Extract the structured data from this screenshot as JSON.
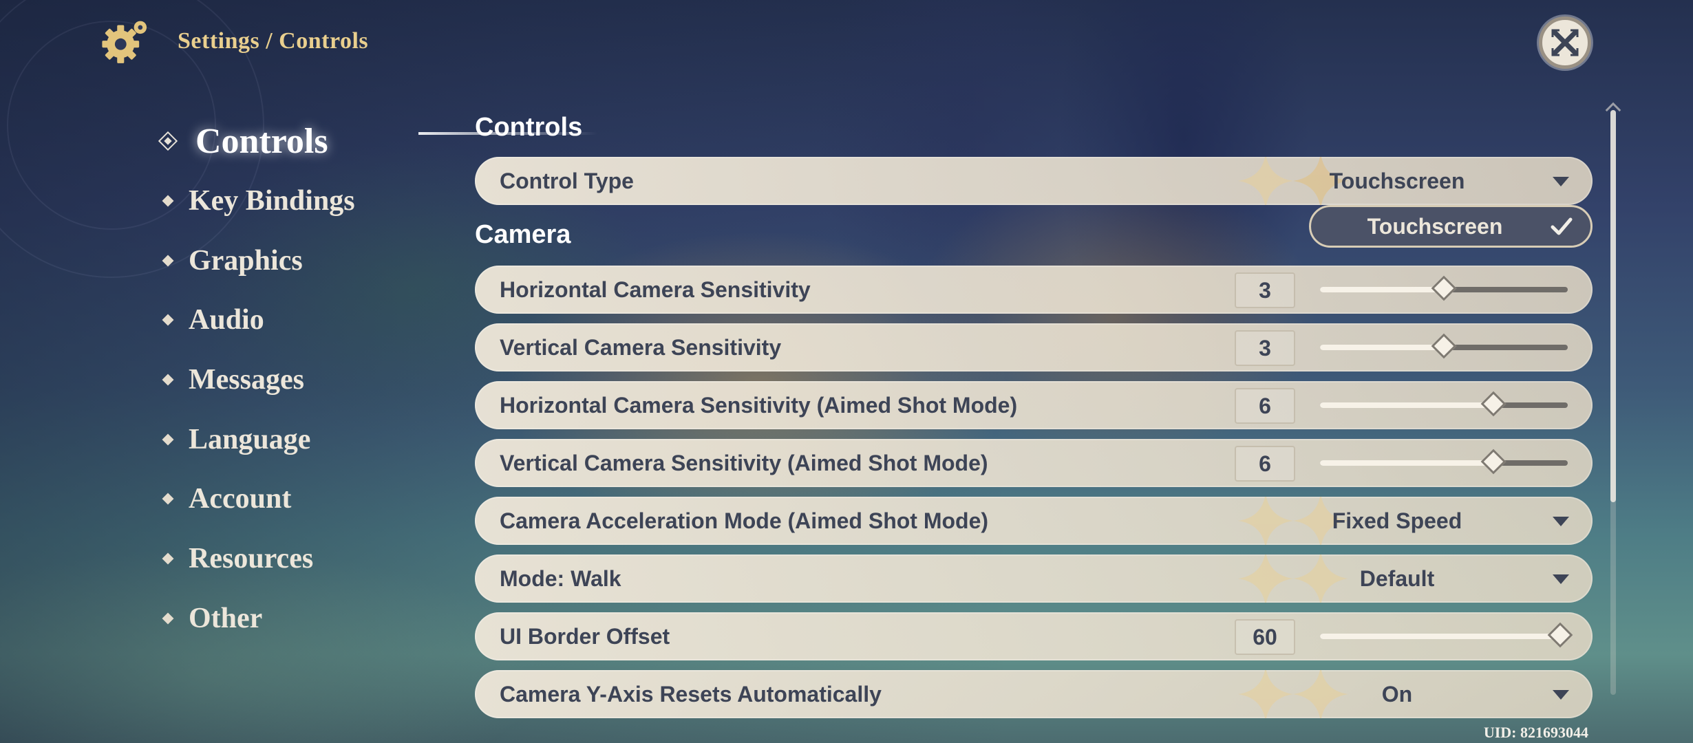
{
  "header": {
    "icon": "gear-icon",
    "breadcrumb": "Settings / Controls",
    "close_icon": "close-icon"
  },
  "sidebar": {
    "items": [
      {
        "label": "Controls",
        "active": true
      },
      {
        "label": "Key Bindings"
      },
      {
        "label": "Graphics"
      },
      {
        "label": "Audio"
      },
      {
        "label": "Messages"
      },
      {
        "label": "Language"
      },
      {
        "label": "Account"
      },
      {
        "label": "Resources"
      },
      {
        "label": "Other"
      }
    ]
  },
  "main": {
    "sections": [
      {
        "heading": "Controls"
      },
      {
        "heading": "Camera"
      }
    ],
    "control_type": {
      "label": "Control Type",
      "value": "Touchscreen"
    },
    "dropdown_open": {
      "option": "Touchscreen",
      "selected": true
    },
    "rows": [
      {
        "label": "Horizontal Camera Sensitivity",
        "type": "slider",
        "value": "3",
        "fraction": 0.5
      },
      {
        "label": "Vertical Camera Sensitivity",
        "type": "slider",
        "value": "3",
        "fraction": 0.5
      },
      {
        "label": "Horizontal Camera Sensitivity (Aimed Shot Mode)",
        "type": "slider",
        "value": "6",
        "fraction": 0.7
      },
      {
        "label": "Vertical Camera Sensitivity (Aimed Shot Mode)",
        "type": "slider",
        "value": "6",
        "fraction": 0.7
      },
      {
        "label": "Camera Acceleration Mode (Aimed Shot Mode)",
        "type": "dropdown",
        "value": "Fixed Speed"
      },
      {
        "label": "Mode: Walk",
        "type": "dropdown",
        "value": "Default"
      },
      {
        "label": "UI Border Offset",
        "type": "slider",
        "value": "60",
        "fraction": 0.97
      },
      {
        "label": "Camera Y-Axis Resets Automatically",
        "type": "dropdown",
        "value": "On"
      }
    ]
  },
  "footer": {
    "uid": "UID: 821693044"
  },
  "colors": {
    "gold": "#e9cf8e",
    "row_text": "#3d4456",
    "row_bg": "#ece5d7",
    "dropdown_bg": "#4b5267"
  }
}
